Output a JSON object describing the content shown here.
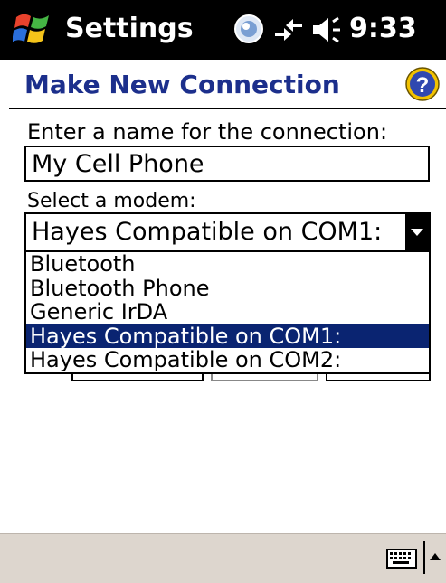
{
  "titlebar": {
    "app_title": "Settings",
    "clock": "9:33",
    "icons": [
      "windows-start-icon",
      "status-orb-icon",
      "connectivity-icon",
      "volume-icon"
    ]
  },
  "header": {
    "title": "Make New Connection",
    "help_icon": "help-icon"
  },
  "form": {
    "name_label": "Enter a name for the connection:",
    "name_value": "My Cell Phone",
    "modem_label": "Select a modem:",
    "modem_selected": "Hayes Compatible on COM1:",
    "modem_options": [
      "Bluetooth",
      "Bluetooth Phone",
      "Generic IrDA",
      "Hayes Compatible on COM1:",
      "Hayes Compatible on COM2:"
    ],
    "selected_index": 3
  },
  "menubar": {
    "icons": [
      "keyboard-icon",
      "sip-arrow-up-icon"
    ]
  },
  "colors": {
    "titlebar_bg": "#000000",
    "header_text": "#1c2f8c",
    "selection_bg": "#0a2471",
    "menubar_bg": "#ddd6ce",
    "help_icon": "#f2c200"
  }
}
